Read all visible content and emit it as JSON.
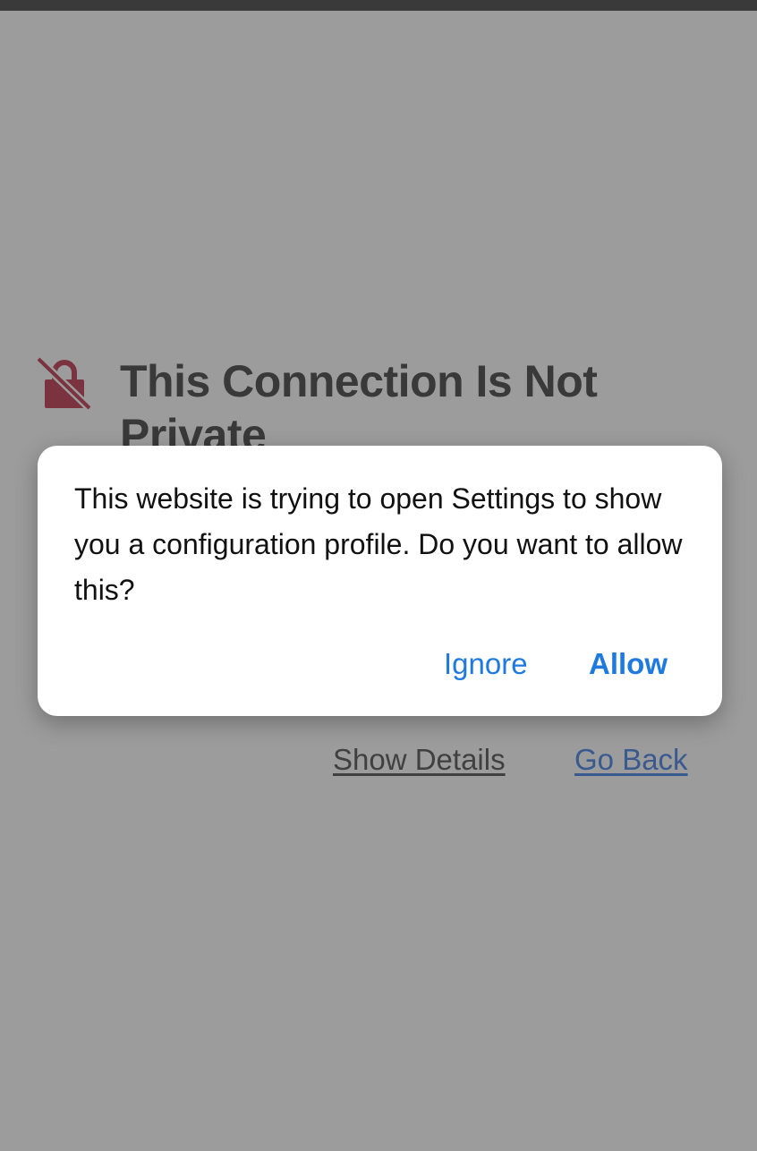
{
  "page": {
    "title": "This Connection Is Not Private",
    "links": {
      "show_details": "Show Details",
      "go_back": "Go Back"
    }
  },
  "alert": {
    "message": "This website is trying to open Settings to show you a configuration profile. Do you want to allow this?",
    "ignore_label": "Ignore",
    "allow_label": "Allow"
  },
  "colors": {
    "warning_icon": "#b0203a",
    "accent": "#1f7ae0",
    "link": "#2b6fd6"
  },
  "icons": {
    "warning": "lock-slash-icon"
  }
}
